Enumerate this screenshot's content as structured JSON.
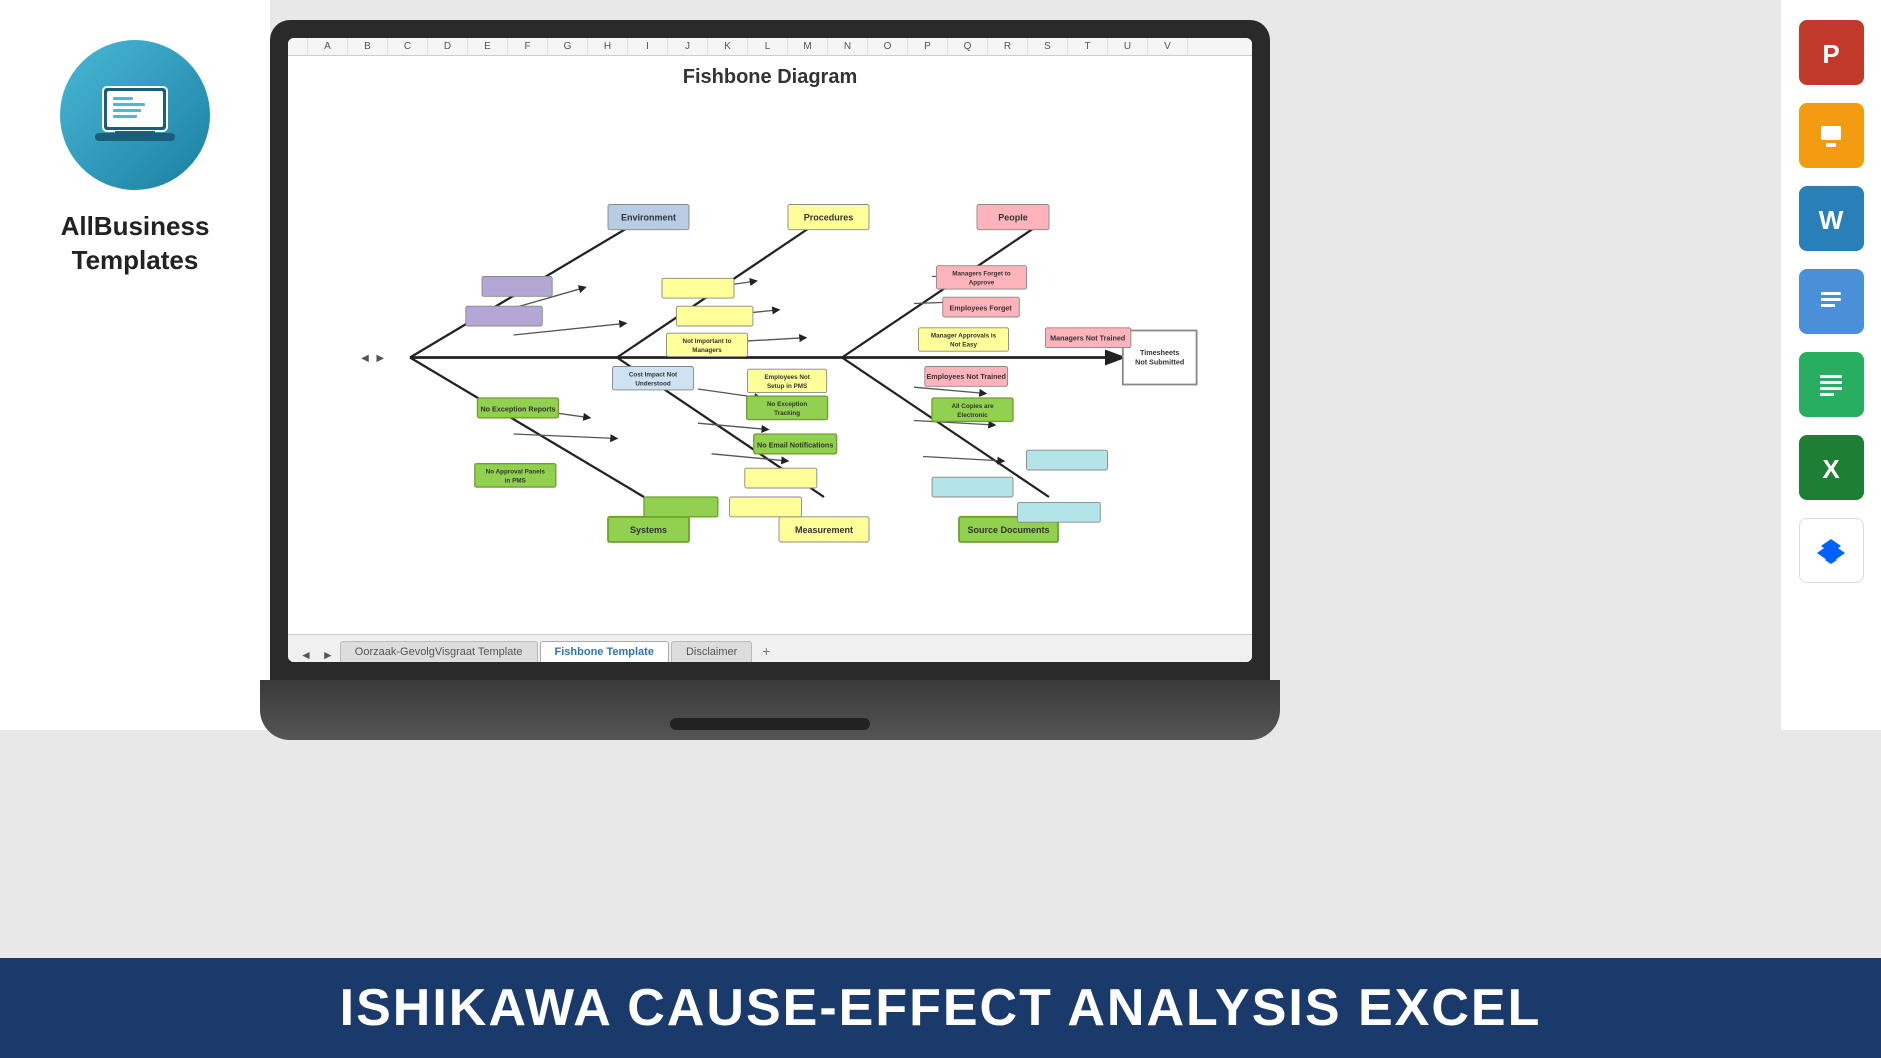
{
  "brand": {
    "name": "AllBusiness\nTemplates",
    "logo_alt": "laptop-list-icon"
  },
  "diagram": {
    "title": "Fishbone Diagram",
    "categories": {
      "environment": "Environment",
      "procedures": "Procedures",
      "people": "People",
      "systems": "Systems",
      "measurement": "Measurement",
      "source_documents": "Source Documents"
    },
    "boxes": {
      "managers_forget_approve": "Managers Forget to Approve",
      "employees_forget": "Employees Forget",
      "managers_not_trained": "Managers Not Trained",
      "not_important_managers": "Not Important to Managers",
      "manager_approvals_not_easy": "Manager Approvals is Not Easy",
      "cost_impact_not_understood": "Cost Impact Not Understood",
      "employees_not_setup": "Employees Not Setup in PMS",
      "employees_not_trained": "Employees Not Trained",
      "timesheets_not_submitted": "Timesheets Not Submitted",
      "no_exception_reports": "No Exception Reports",
      "no_exception_tracking": "No Exception Tracking",
      "all_copies_electronic": "All Copies are Electronic",
      "no_email_notifications": "No Email Notifications",
      "no_approval_panels": "No Approval Panels in PMS"
    }
  },
  "sheet_tabs": {
    "tab1": "Oorzaak-GevolgVisgraat Template",
    "tab2": "Fishbone Template",
    "tab3": "Disclaimer",
    "add": "+"
  },
  "app_icons": {
    "powerpoint": "P",
    "slides": "S",
    "word": "W",
    "docs": "D",
    "sheets_green": "S",
    "excel": "X",
    "dropbox": "💧"
  },
  "banner": {
    "text": "ISHIKAWA CAUSE-EFFECT ANALYSIS  EXCEL"
  },
  "col_headers": [
    "A",
    "B",
    "C",
    "D",
    "E",
    "F",
    "G",
    "H",
    "I",
    "J",
    "K",
    "L",
    "M",
    "N",
    "O",
    "P",
    "Q",
    "R",
    "S",
    "T",
    "U",
    "V"
  ]
}
